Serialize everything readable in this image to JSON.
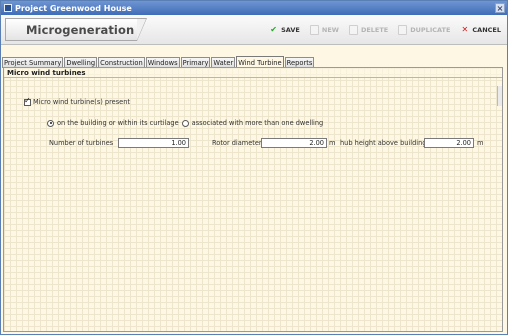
{
  "window": {
    "title": "Project Greenwood House",
    "close_glyph": "×"
  },
  "header": {
    "module_title": "Microgeneration"
  },
  "toolbar": {
    "save_label": "SAVE",
    "new_label": "NEW",
    "delete_label": "DELETE",
    "duplicate_label": "DUPLICATE",
    "cancel_label": "CANCEL",
    "icons": {
      "save": "checkmark-icon",
      "new": "new-document-icon",
      "delete": "delete-document-icon",
      "duplicate": "duplicate-document-icon",
      "cancel": "cross-icon"
    },
    "colors": {
      "save": "#28a428",
      "cancel": "#d21b1b",
      "disabled": "#b4b4b4"
    }
  },
  "tabs": [
    {
      "label": "Project Summary",
      "active": false
    },
    {
      "label": "Dwelling",
      "active": false
    },
    {
      "label": "Construction",
      "active": false
    },
    {
      "label": "Windows",
      "active": false
    },
    {
      "label": "Primary",
      "active": false
    },
    {
      "label": "Water",
      "active": false
    },
    {
      "label": "Wind Turbine",
      "active": true
    },
    {
      "label": "Reports",
      "active": false
    }
  ],
  "section": {
    "title": "Micro wind turbines",
    "present_checkbox": {
      "label": "Micro wind turbine(s) present",
      "checked": true
    },
    "location_options": [
      {
        "label": "on the building or within its curtilage",
        "selected": true
      },
      {
        "label": "associated with more than one dwelling",
        "selected": false
      }
    ],
    "fields": {
      "turbines": {
        "label": "Number of turbines",
        "value": "1.00"
      },
      "rotor": {
        "label": "Rotor diameter",
        "value": "2.00",
        "unit": "m"
      },
      "hub": {
        "label": "hub height above building",
        "value": "2.00",
        "unit": "m"
      }
    }
  }
}
